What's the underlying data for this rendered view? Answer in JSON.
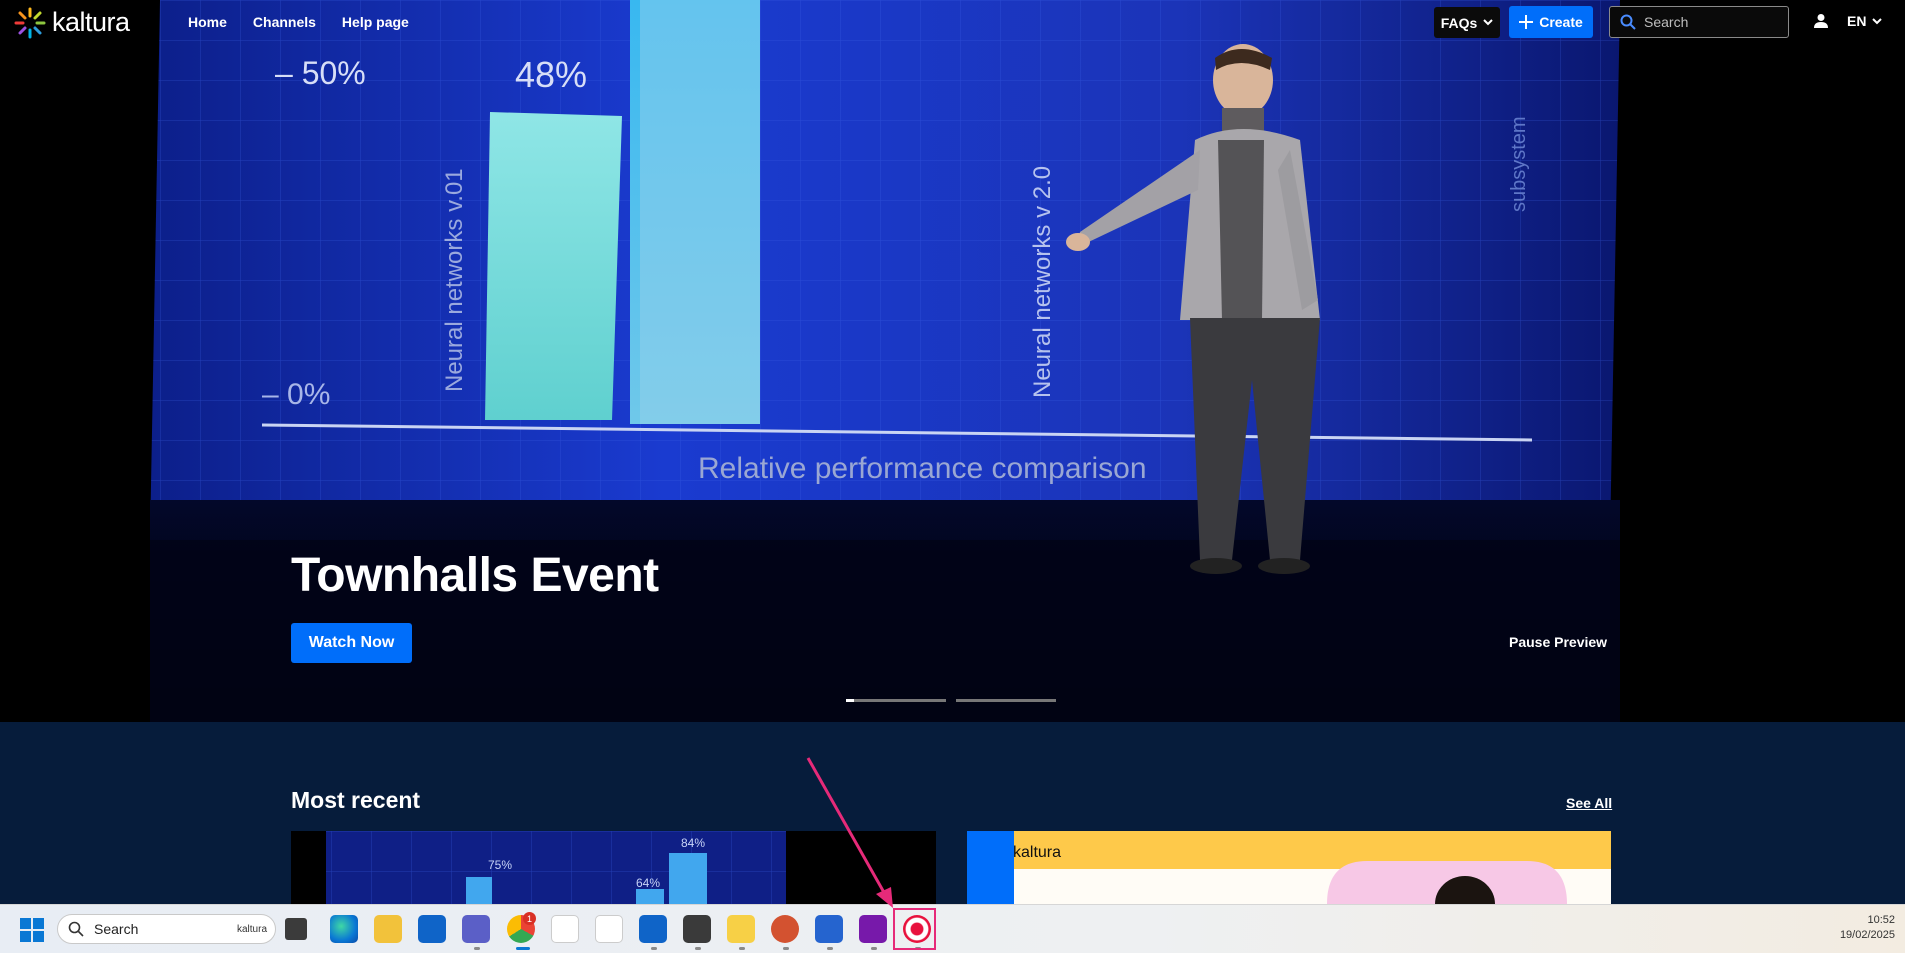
{
  "header": {
    "brand": "kaltura",
    "nav": [
      "Home",
      "Channels",
      "Help page"
    ],
    "faqs_label": "FAQs",
    "create_label": "Create",
    "search_placeholder": "Search",
    "language": "EN"
  },
  "hero": {
    "title": "Townhalls Event",
    "watch_label": "Watch Now",
    "pause_label": "Pause Preview",
    "screen_text": {
      "pct_50": "– 50%",
      "pct_48": "48%",
      "pct_0": "– 0%",
      "bar1_label": "Neural networks v.01",
      "bar2_label": "Neural networks v 2.0",
      "side_label": "subsystem",
      "axis_caption": "Relative performance comparison"
    },
    "slides_count": 2,
    "active_slide": 0
  },
  "recent": {
    "title": "Most recent",
    "see_all": "See All",
    "card1_labels": [
      "75%",
      "64%",
      "84%"
    ],
    "card2_brand": "kaltura"
  },
  "taskbar": {
    "search_placeholder": "Search",
    "search_brand": "kaltura",
    "time": "10:52",
    "date": "19/02/2025",
    "chrome_badge": "1",
    "apps": [
      "task-view-icon",
      "edge-icon",
      "file-explorer-icon",
      "outlook-icon",
      "teams-icon",
      "chrome-icon",
      "kaltura-app-icon",
      "company-portal-icon",
      "outlook-new-icon",
      "sublime-icon",
      "sticky-notes-icon",
      "powerpoint-icon",
      "todo-icon",
      "onenote-icon",
      "kaltura-capture-icon"
    ]
  },
  "colors": {
    "accent": "#006efa",
    "recent_bg": "#061c3b",
    "highlight": "#e62a79"
  }
}
